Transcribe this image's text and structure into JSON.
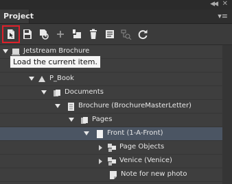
{
  "panel": {
    "tab_label": "Project",
    "menu_icon": "panel-menu-icon"
  },
  "toolbar": {
    "buttons": [
      {
        "name": "load-item-button",
        "icon": "load-icon"
      },
      {
        "name": "save-button",
        "icon": "save-icon"
      },
      {
        "name": "sync-button",
        "icon": "sync-icon"
      },
      {
        "name": "add-button",
        "icon": "plus-icon"
      },
      {
        "name": "copy-button",
        "icon": "copy-icon"
      },
      {
        "name": "delete-button",
        "icon": "trash-icon"
      },
      {
        "name": "properties-button",
        "icon": "properties-icon"
      },
      {
        "name": "structure-button",
        "icon": "structure-icon"
      },
      {
        "name": "refresh-button",
        "icon": "refresh-icon"
      }
    ]
  },
  "tooltip": "Load the current item.",
  "tree": {
    "rows": [
      {
        "label": "Jetstream Brochure"
      },
      {
        "label": ""
      },
      {
        "label": "P_Book"
      },
      {
        "label": "Documents"
      },
      {
        "label": "Brochure (BrochureMasterLetter)"
      },
      {
        "label": "Pages"
      },
      {
        "label": "Front (1-A-Front)"
      },
      {
        "label": "Page Objects"
      },
      {
        "label": "Venice (Venice)"
      },
      {
        "label": "Note for new photo"
      }
    ]
  }
}
